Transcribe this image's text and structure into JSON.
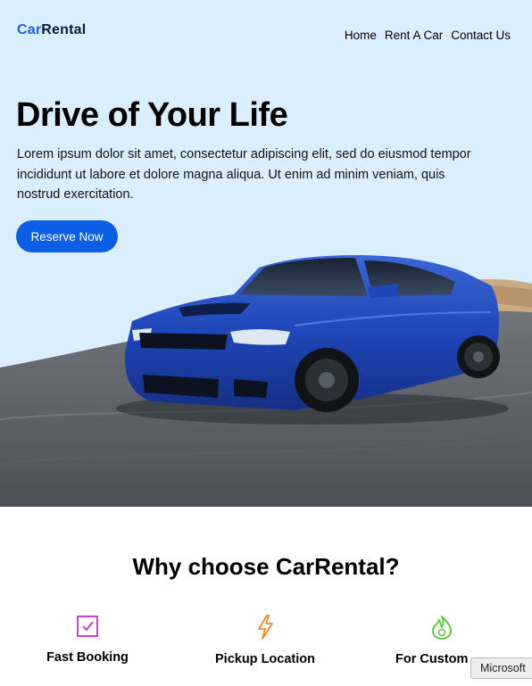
{
  "brand": {
    "part1": "Car",
    "part2": "Rental"
  },
  "nav": {
    "home": "Home",
    "rent": "Rent A Car",
    "contact": "Contact Us"
  },
  "hero": {
    "title": "Drive of Your Life",
    "text": "Lorem ipsum dolor sit amet, consectetur adipiscing elit, sed do eiusmod tempor incididunt ut labore et dolore magna aliqua. Ut enim ad minim veniam, quis nostrud exercitation.",
    "cta": "Reserve Now",
    "image": "blue-sports-sedan-photo"
  },
  "why": {
    "title": "Why choose CarRental?",
    "features": [
      {
        "label": "Fast Booking",
        "icon": "checkbox-icon"
      },
      {
        "label": "Pickup Location",
        "icon": "lightning-icon"
      },
      {
        "label": "For Custom",
        "icon": "flame-icon"
      }
    ]
  },
  "tooltip": "Microsoft",
  "colors": {
    "accent": "#0b5fe6",
    "heroBg": "#daeefe",
    "car": "#1f46b8"
  }
}
